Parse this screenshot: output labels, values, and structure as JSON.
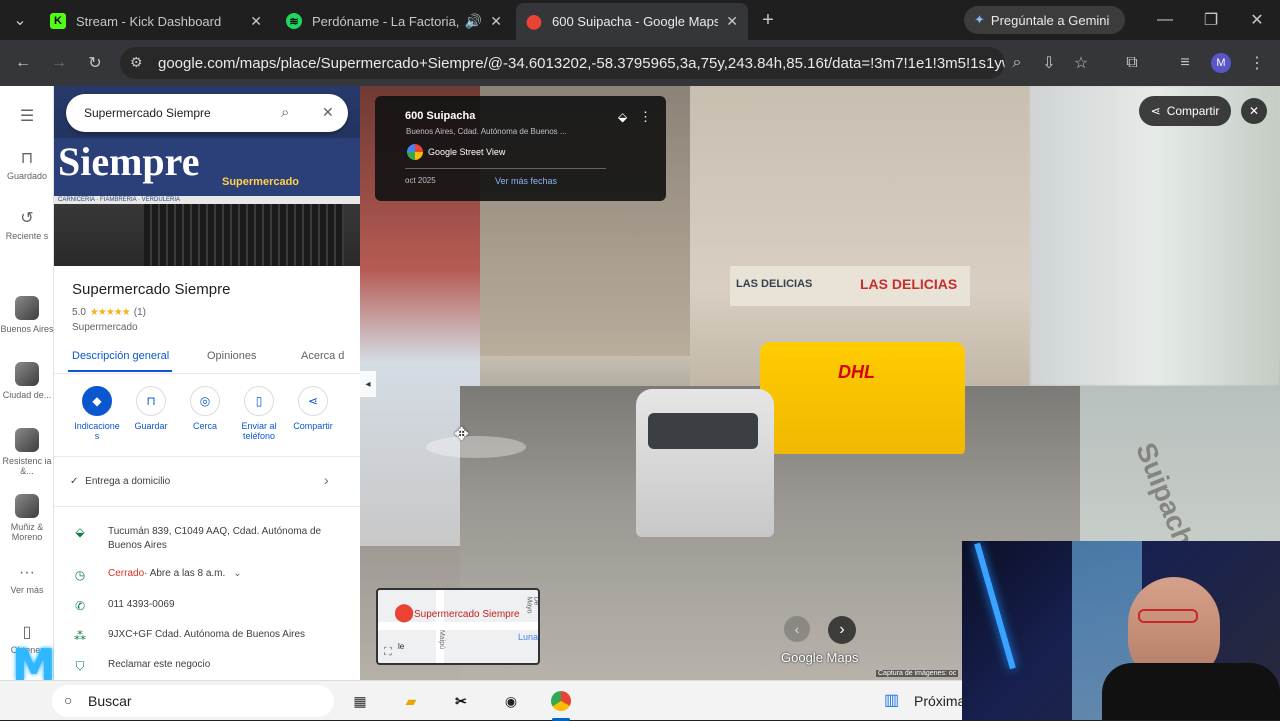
{
  "browser": {
    "tabs": [
      {
        "label": "Stream - Kick Dashboard",
        "icon": "kick-icon",
        "color": "#53fc18"
      },
      {
        "label": "Perdóname - La Factoria, Ed",
        "icon": "spotify-icon",
        "color": "#1ed760"
      },
      {
        "label": "600 Suipacha - Google Maps",
        "icon": "maps-pin-icon",
        "color": "#ea4335"
      }
    ],
    "gemini_label": "Pregúntale a Gemini",
    "url": "google.com/maps/place/Supermercado+Siempre/@-34.6013202,-58.3795965,3a,75y,243.84h,85.16t/data=!3m7!1e1!3m5!1s1ywmb5v...",
    "profile_initial": "M"
  },
  "rail": {
    "items": [
      {
        "label": "Guardado",
        "icon": "bookmark-icon"
      },
      {
        "label": "Reciente s",
        "icon": "history-icon"
      },
      {
        "label": "Buenos Aires"
      },
      {
        "label": "Ciudad de..."
      },
      {
        "label": "Resistenc ia &..."
      },
      {
        "label": "Muñiz & Moreno"
      },
      {
        "label": "Ver más",
        "icon": "more-icon"
      },
      {
        "label": "Obtener"
      }
    ]
  },
  "panel": {
    "search_value": "Supermercado Siempre",
    "sign_top": "Siempre",
    "sign_sub": "Supermercado",
    "sign_strip": "CARNICERIA · FIAMBRERIA · VERDULERIA",
    "place_name": "Supermercado Siempre",
    "rating": "5.0",
    "stars": "★★★★★",
    "review_count": "(1)",
    "category": "Supermercado",
    "tabs": [
      "Descripción general",
      "Opiniones",
      "Acerca d"
    ],
    "actions": [
      {
        "label": "Indicacione s",
        "icon": "directions-icon"
      },
      {
        "label": "Guardar",
        "icon": "bookmark-icon"
      },
      {
        "label": "Cerca",
        "icon": "nearby-icon"
      },
      {
        "label": "Enviar al teléfono",
        "icon": "phone-send-icon"
      },
      {
        "label": "Compartir",
        "icon": "share-icon"
      }
    ],
    "delivery": "Entrega a domicilio",
    "address": "Tucumán 839, C1049 AAQ, Cdad. Autónoma de Buenos Aires",
    "hours_status": "Cerrado",
    "hours_rest": " · Abre a las 8 a.m.",
    "phone": "011 4393-0069",
    "plus_code": "9JXC+GF Cdad. Autónoma de Buenos Aires",
    "claim": "Reclamar este negocio"
  },
  "streetview": {
    "title": "600 Suipacha",
    "subtitle": "Buenos Aires, Cdad. Autónoma de Buenos ...",
    "source": "Google Street View",
    "date": "oct 2025",
    "more_dates": "Ver más fechas",
    "share": "Compartir",
    "sign_delicias_1": "LAS DELICIAS",
    "sign_delicias_2": "LAS DELICIAS",
    "dhl": "DHL",
    "street_name": "Suipacha",
    "minimap_label": "Supermercado Siempre",
    "minimap_street_1": "De Mayo",
    "minimap_street_2": "Maipú",
    "minimap_luna": "Luna",
    "minimap_le": "le",
    "logo": "Google Maps",
    "capture": "Captura de imágenes: oc"
  },
  "taskbar": {
    "search_placeholder": "Buscar",
    "next_label": "Próxima"
  }
}
